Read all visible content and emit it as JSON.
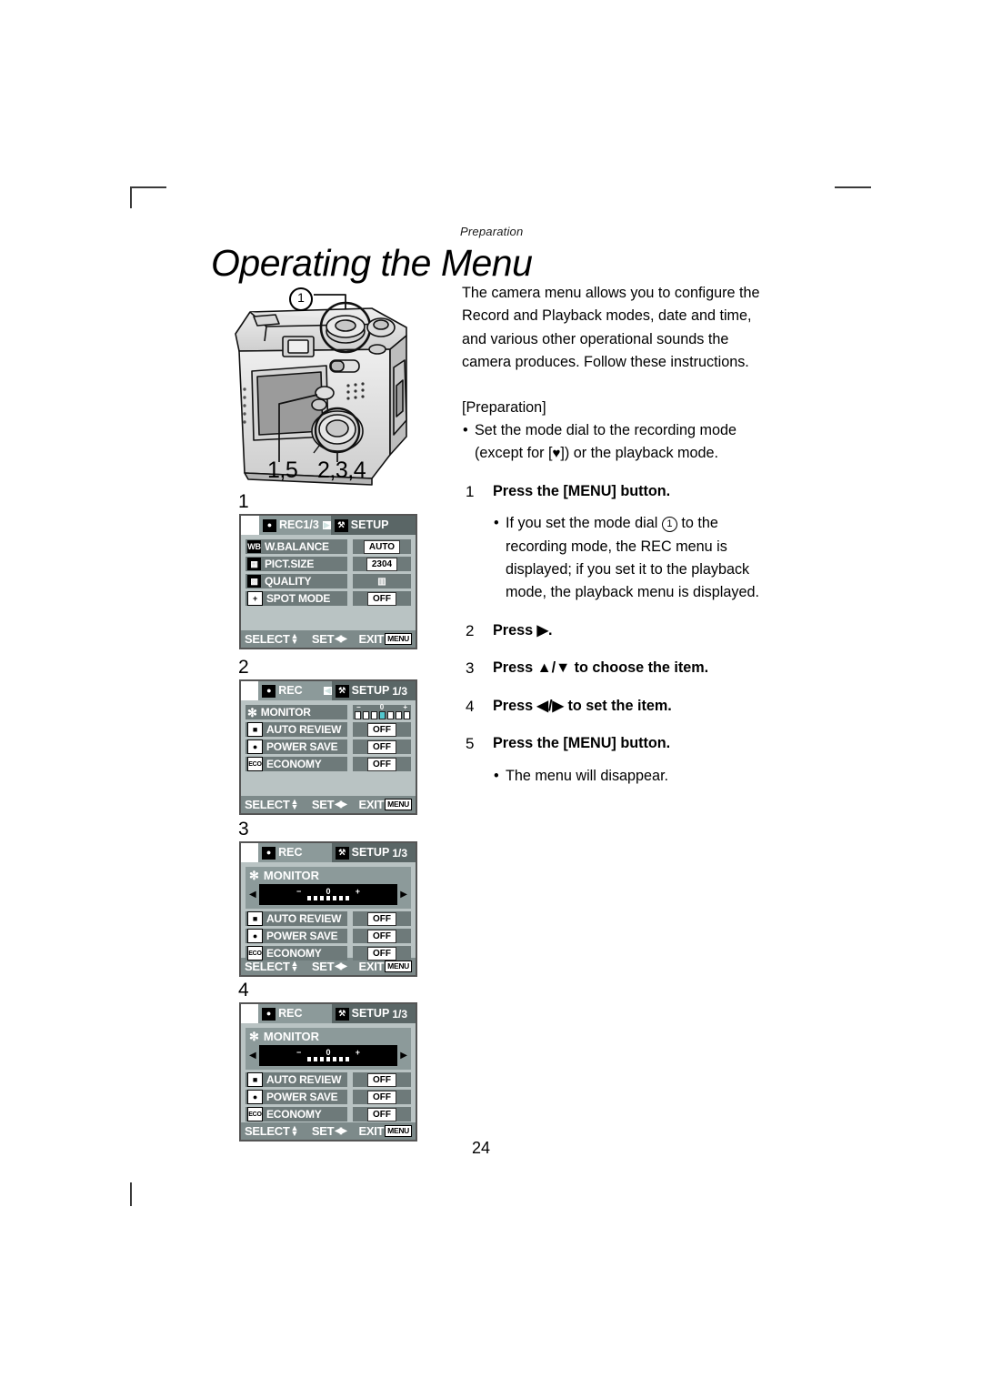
{
  "document": {
    "running_head": "Preparation",
    "title": "Operating the Menu",
    "page_number": "24"
  },
  "intro": {
    "paragraph_lines": [
      "The camera menu allows you to configure the",
      "Record and Playback modes, date and time,",
      "and various other operational sounds the",
      "camera produces. Follow these instructions."
    ],
    "preparation_heading": "[Preparation]",
    "preparation_bullet_line1": "Set the mode dial to the recording mode",
    "preparation_bullet_line2_pre": "(except for [",
    "preparation_bullet_line2_post": "]) or the playback mode.",
    "heart_glyph": "♥"
  },
  "steps": [
    {
      "num": "1",
      "text": "Press the [MENU] button.",
      "sub_lines": [
        "If you set the mode dial ① to the",
        "recording mode,  the REC menu is",
        "displayed; if you set it to the playback",
        "mode, the playback menu is displayed."
      ]
    },
    {
      "num": "2",
      "text": "Press ▶."
    },
    {
      "num": "3",
      "text": "Press ▲/▼ to choose the item."
    },
    {
      "num": "4",
      "text": "Press ◀/▶ to set the item."
    },
    {
      "num": "5",
      "text": "Press the [MENU] button.",
      "sub_lines": [
        "The menu will disappear."
      ]
    }
  ],
  "camera_figure": {
    "callout_label": "1",
    "label_menu_button": "1,5",
    "label_cursor_button": "2,3,4"
  },
  "screens": [
    {
      "step_index": "1",
      "header": {
        "rec_icon": "camera-icon",
        "rec_label": "REC1/3",
        "separator": "▶",
        "setup_icon": "tools-icon",
        "setup_label": "SETUP",
        "page_indicator": ""
      },
      "rows": [
        {
          "icon": "WB",
          "icon_style": "text",
          "label": "W.BALANCE",
          "value": "AUTO",
          "value_style": "box"
        },
        {
          "icon": "▦",
          "icon_style": "grid",
          "label": "PICT.SIZE",
          "value": "2304",
          "value_style": "box"
        },
        {
          "icon": "▥",
          "icon_style": "bars",
          "label": "QUALITY",
          "value": "▥",
          "value_style": "icon"
        },
        {
          "icon": "+",
          "icon_style": "plus",
          "label": "SPOT MODE",
          "value": "OFF",
          "value_style": "box"
        }
      ],
      "footer": {
        "select": "SELECT",
        "set": "SET",
        "exit": "EXIT",
        "menu_key": "MENU"
      }
    },
    {
      "step_index": "2",
      "header": {
        "rec_icon": "camera-icon",
        "rec_label": "REC",
        "separator": "◀",
        "setup_icon": "tools-icon",
        "setup_label": "SETUP",
        "page_indicator": "1/3"
      },
      "rows": [
        {
          "icon": "✻",
          "icon_style": "sun",
          "label": "MONITOR",
          "value": "slider",
          "value_style": "slider-mini"
        },
        {
          "icon": "▣",
          "icon_style": "review",
          "label": "AUTO REVIEW",
          "value": "OFF",
          "value_style": "box"
        },
        {
          "icon": "▣",
          "icon_style": "sleep",
          "label": "POWER SAVE",
          "value": "OFF",
          "value_style": "box"
        },
        {
          "icon": "ECO",
          "icon_style": "text",
          "label": "ECONOMY",
          "value": "OFF",
          "value_style": "box"
        }
      ],
      "slider": {
        "minus": "−",
        "zero": "0",
        "plus": "+",
        "cells": 7,
        "selected_index": 3
      },
      "footer": {
        "select": "SELECT",
        "set": "SET",
        "exit": "EXIT",
        "menu_key": "MENU"
      }
    },
    {
      "step_index": "3",
      "header": {
        "rec_icon": "camera-icon",
        "rec_label": "REC",
        "separator": "",
        "setup_icon": "tools-icon",
        "setup_label": "SETUP",
        "page_indicator": "1/3"
      },
      "monitor": {
        "label": "MONITOR",
        "minus": "−",
        "zero": "0",
        "plus": "+",
        "cells": 7,
        "left_arrow": "◀",
        "right_arrow": "▶"
      },
      "rows": [
        {
          "icon": "▣",
          "icon_style": "review",
          "label": "AUTO REVIEW",
          "value": "OFF",
          "value_style": "box"
        },
        {
          "icon": "▣",
          "icon_style": "sleep",
          "label": "POWER SAVE",
          "value": "OFF",
          "value_style": "box"
        },
        {
          "icon": "ECO",
          "icon_style": "text",
          "label": "ECONOMY",
          "value": "OFF",
          "value_style": "box"
        }
      ],
      "footer": {
        "select": "SELECT",
        "set": "SET",
        "exit": "EXIT",
        "menu_key": "MENU"
      }
    },
    {
      "step_index": "4",
      "header": {
        "rec_icon": "camera-icon",
        "rec_label": "REC",
        "separator": "",
        "setup_icon": "tools-icon",
        "setup_label": "SETUP",
        "page_indicator": "1/3"
      },
      "monitor": {
        "label": "MONITOR",
        "minus": "−",
        "zero": "0",
        "plus": "+",
        "cells": 7,
        "left_arrow": "◀",
        "right_arrow": "▶"
      },
      "rows": [
        {
          "icon": "▣",
          "icon_style": "review",
          "label": "AUTO REVIEW",
          "value": "OFF",
          "value_style": "box"
        },
        {
          "icon": "▣",
          "icon_style": "sleep",
          "label": "POWER SAVE",
          "value": "OFF",
          "value_style": "box"
        },
        {
          "icon": "ECO",
          "icon_style": "text",
          "label": "ECONOMY",
          "value": "OFF",
          "value_style": "box"
        }
      ],
      "footer": {
        "select": "SELECT",
        "set": "SET",
        "exit": "EXIT",
        "menu_key": "MENU"
      }
    }
  ],
  "colors": {
    "lcd_background": "#b9c3c3",
    "lcd_header": "#8c9a9a",
    "lcd_row": "#6e7a7a",
    "lcd_footer": "#7d8a8a",
    "slider_selected": "#53c8cf",
    "setup_tab": "#5a6666"
  }
}
